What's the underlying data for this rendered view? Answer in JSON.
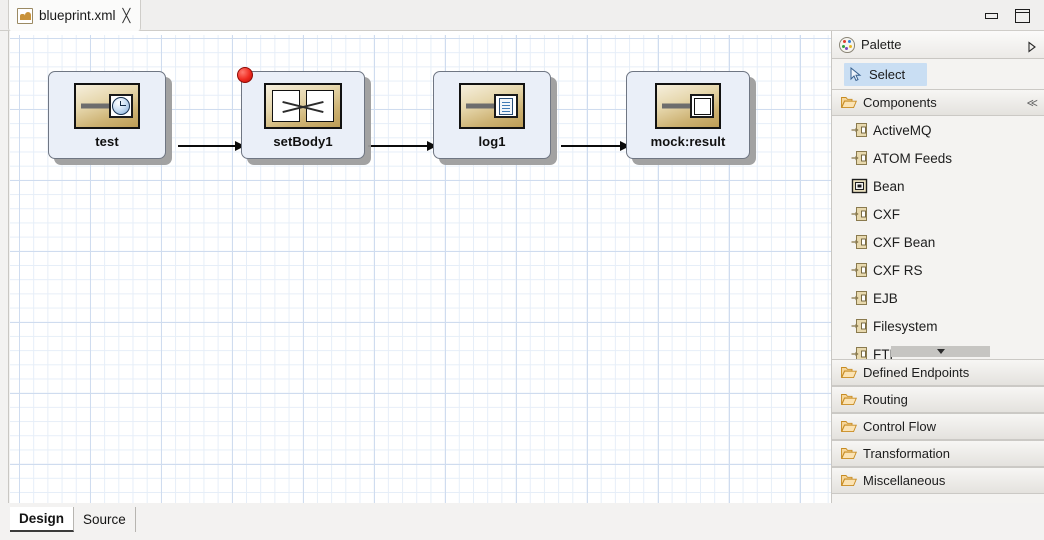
{
  "window": {
    "tab_label": "blueprint.xml",
    "tab_icon": "camel-file-icon",
    "close_icon": "close-icon",
    "minimize_label": "Minimize",
    "maximize_label": "Maximize"
  },
  "canvas": {
    "nodes": [
      {
        "id": "test",
        "label": "test",
        "icon": "timer-endpoint-icon",
        "breakpoint": false
      },
      {
        "id": "setBody1",
        "label": "setBody1",
        "icon": "set-body-icon",
        "breakpoint": true
      },
      {
        "id": "log1",
        "label": "log1",
        "icon": "log-endpoint-icon",
        "breakpoint": false
      },
      {
        "id": "mockresult",
        "label": "mock:result",
        "icon": "mock-endpoint-icon",
        "breakpoint": false
      }
    ],
    "connections": [
      {
        "from": "test",
        "to": "setBody1"
      },
      {
        "from": "setBody1",
        "to": "log1"
      },
      {
        "from": "log1",
        "to": "mockresult"
      }
    ]
  },
  "palette": {
    "title": "Palette",
    "title_icon": "palette-icon",
    "expand_icon": "triangle-right-icon",
    "select": {
      "label": "Select",
      "icon": "cursor-arrow-icon",
      "selected": true
    },
    "components_group": {
      "label": "Components",
      "icon": "folder-open-icon",
      "collapse_icon": "collapse-all-icon",
      "items": [
        {
          "label": "ActiveMQ",
          "icon": "endpoint-icon"
        },
        {
          "label": "ATOM Feeds",
          "icon": "endpoint-icon"
        },
        {
          "label": "Bean",
          "icon": "bean-icon"
        },
        {
          "label": "CXF",
          "icon": "endpoint-icon"
        },
        {
          "label": "CXF Bean",
          "icon": "endpoint-icon"
        },
        {
          "label": "CXF RS",
          "icon": "endpoint-icon"
        },
        {
          "label": "EJB",
          "icon": "endpoint-icon"
        },
        {
          "label": "Filesystem",
          "icon": "endpoint-icon"
        },
        {
          "label": "FTP",
          "icon": "endpoint-icon"
        }
      ],
      "scroll_down_icon": "scroll-down-arrow-icon"
    },
    "groups": [
      {
        "label": "Defined Endpoints",
        "icon": "folder-open-icon"
      },
      {
        "label": "Routing",
        "icon": "folder-open-icon"
      },
      {
        "label": "Control Flow",
        "icon": "folder-open-icon"
      },
      {
        "label": "Transformation",
        "icon": "folder-open-icon"
      },
      {
        "label": "Miscellaneous",
        "icon": "folder-open-icon"
      }
    ]
  },
  "bottom_tabs": [
    {
      "label": "Design",
      "active": true
    },
    {
      "label": "Source",
      "active": false
    }
  ],
  "colors": {
    "select_highlight": "#c9def3",
    "node_fill": "#eaeff8",
    "node_icon_gold": "#cdb273",
    "breakpoint_red": "#ef2a20",
    "grid_line": "#e6eef8"
  }
}
